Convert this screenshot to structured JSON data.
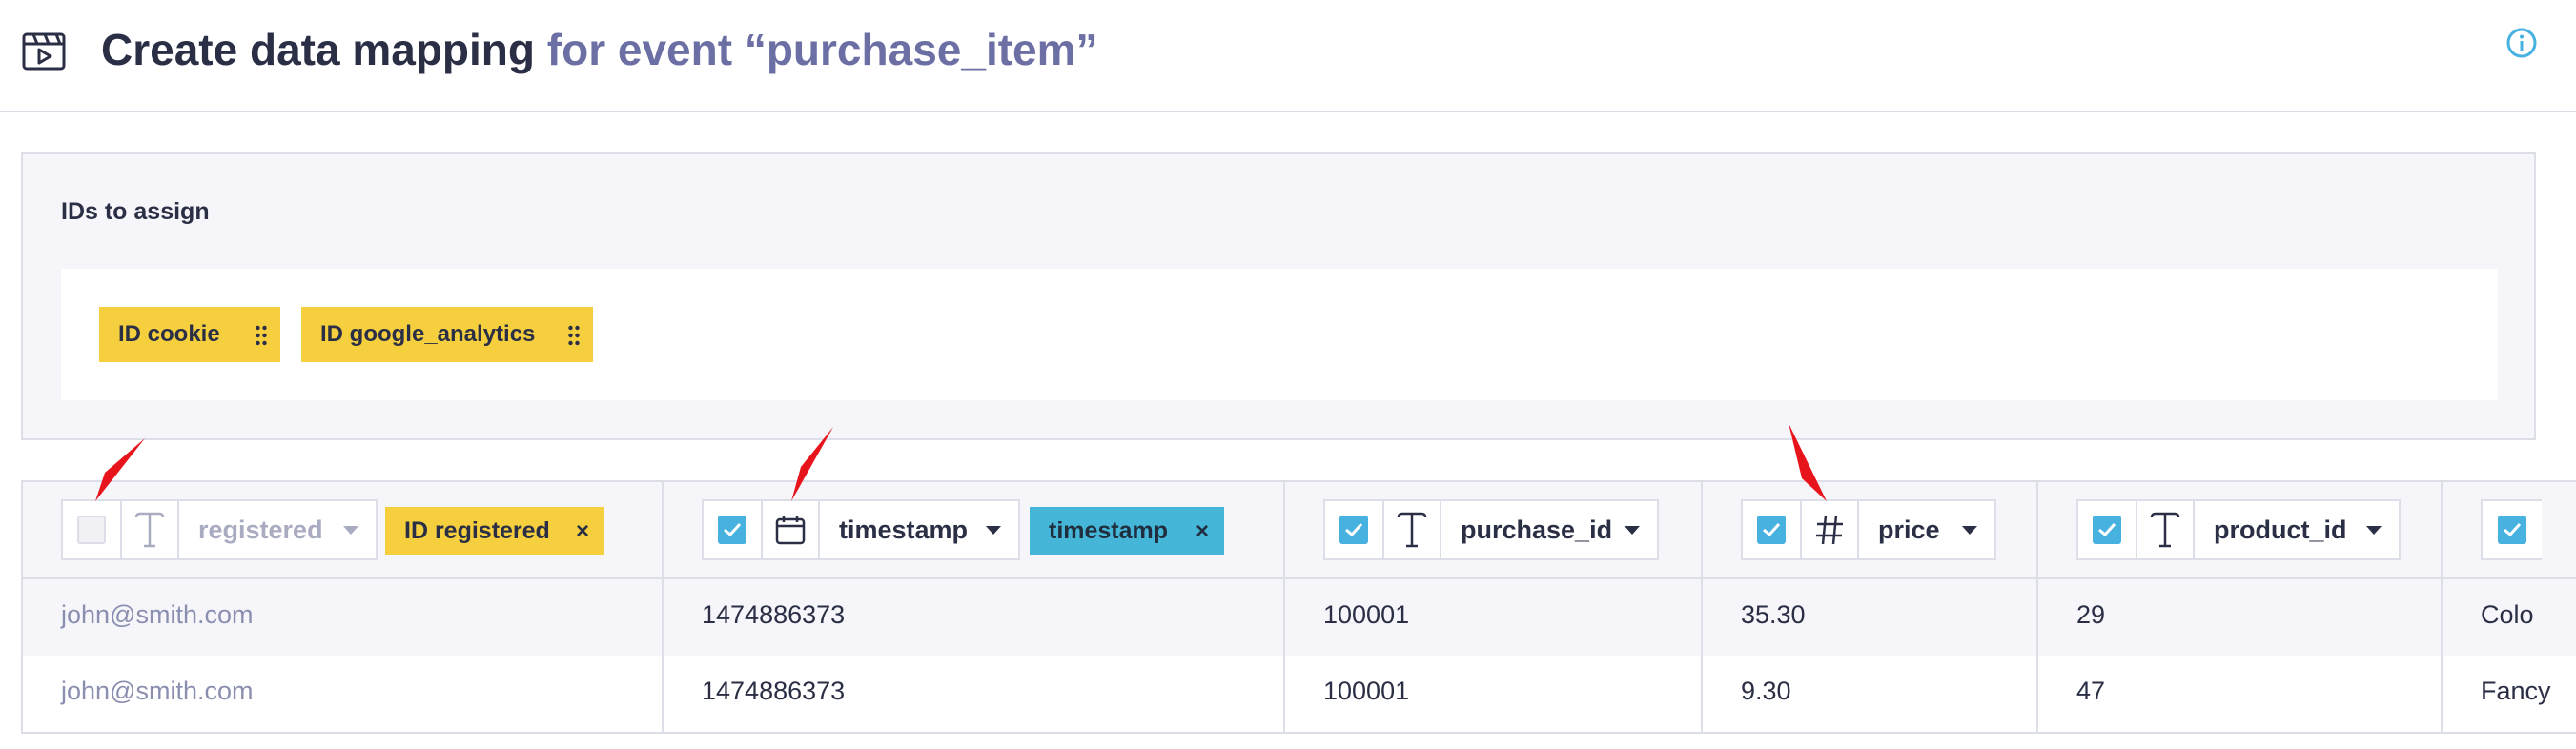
{
  "header": {
    "title": "Create data mapping",
    "subtitle": "for event “purchase_item”",
    "logo_icon": "film-clapper-icon",
    "info_icon": "info-icon"
  },
  "ids_panel": {
    "label": "IDs to assign",
    "chips": [
      {
        "label": "ID cookie"
      },
      {
        "label": "ID google_analytics"
      }
    ]
  },
  "columns": [
    {
      "checked": false,
      "type_icon": "text-type-icon",
      "name": "registered",
      "mapped_tag": "ID registered",
      "tag_color": "yellow"
    },
    {
      "checked": true,
      "type_icon": "calendar-icon",
      "name": "timestamp",
      "mapped_tag": "timestamp",
      "tag_color": "blue"
    },
    {
      "checked": true,
      "type_icon": "text-type-icon",
      "name": "purchase_id",
      "mapped_tag": ""
    },
    {
      "checked": true,
      "type_icon": "hash-icon",
      "name": "price",
      "mapped_tag": ""
    },
    {
      "checked": true,
      "type_icon": "text-type-icon",
      "name": "product_id",
      "mapped_tag": ""
    },
    {
      "checked": true,
      "type_icon": "",
      "name": "",
      "mapped_tag": ""
    }
  ],
  "rows": [
    [
      "john@smith.com",
      "1474886373",
      "100001",
      "35.30",
      "29",
      "Colo"
    ],
    [
      "john@smith.com",
      "1474886373",
      "100001",
      "9.30",
      "47",
      "Fancy"
    ]
  ],
  "tag_remove_symbol": "×",
  "colors": {
    "accent": "#47b1e0",
    "id_tag": "#f6cf3e",
    "timestamp_tag": "#45b6d8",
    "annotation_arrow": "#e8141b",
    "subtitle": "#6b6fa3"
  }
}
